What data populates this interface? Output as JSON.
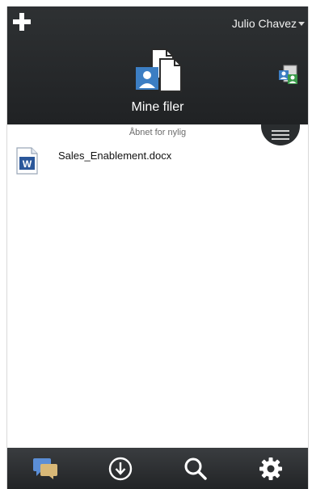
{
  "header": {
    "user_name": "Julio Chavez",
    "title": "Mine filer"
  },
  "main": {
    "section_label": "Åbnet for nylig",
    "files": [
      {
        "name": "Sales_Enablement.docx",
        "icon": "word-document-icon"
      }
    ]
  },
  "tabbar": {
    "items": [
      {
        "icon": "chat-icon"
      },
      {
        "icon": "download-icon"
      },
      {
        "icon": "search-icon"
      },
      {
        "icon": "gear-icon"
      }
    ]
  },
  "colors": {
    "header_bg": "#2b2e30",
    "accent_blue": "#3c7ec3",
    "word_blue": "#2b579a",
    "shared_green": "#3a9a4a"
  }
}
